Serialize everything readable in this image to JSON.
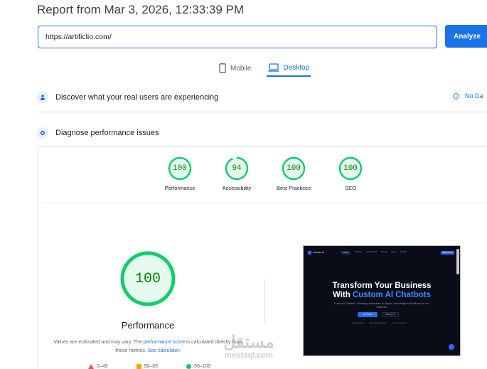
{
  "report": {
    "title": "Report from Mar 3, 2026, 12:33:39 PM"
  },
  "search": {
    "url": "https://artificlio.com/",
    "analyze_label": "Analyze"
  },
  "device_tabs": {
    "mobile": "Mobile",
    "desktop": "Desktop",
    "active": "desktop"
  },
  "sections": {
    "real_users": "Discover what your real users are experiencing",
    "no_data": "No Da",
    "diagnose": "Diagnose performance issues"
  },
  "scores": [
    {
      "label": "Performance",
      "value": "100",
      "fraction": 1.0,
      "color": "#0cce6b"
    },
    {
      "label": "Accessibility",
      "value": "94",
      "fraction": 0.94,
      "color": "#0cce6b"
    },
    {
      "label": "Best Practices",
      "value": "100",
      "fraction": 1.0,
      "color": "#0cce6b"
    },
    {
      "label": "SEO",
      "value": "100",
      "fraction": 1.0,
      "color": "#0cce6b"
    }
  ],
  "performance": {
    "score": "100",
    "title": "Performance",
    "note_pre": "Values are estimated and may vary. The ",
    "note_link1": "performance score",
    "note_mid": " is calculated directly from these metrics. ",
    "note_link2": "See calculator."
  },
  "legend": {
    "fail": "0–49",
    "average": "50–89",
    "pass": "90–100"
  },
  "screenshot": {
    "logo": "Artificlio AI",
    "nav": [
      "Home",
      "Services",
      "Case Studies",
      "Pricing",
      "About",
      "Contact"
    ],
    "cta": "Book a Call",
    "headline1": "Transform Your Business",
    "headline2_pre": "With ",
    "headline2_blue": "Custom AI Chatbots",
    "subtext": "Custom AI Chatbots, WhatsApp Automation, AI Agents, and Intelligent Workflows for Your Business.",
    "btn_primary": "Get Started",
    "btn_secondary": "WhatsApp Us",
    "features": [
      "24/7 Availability",
      "Multi-Channel Support",
      "Custom Integrations"
    ]
  },
  "watermark": {
    "arabic": "مستقل",
    "latin": "mostaql.com"
  },
  "colors": {
    "accent": "#1a73e8",
    "pass": "#0cce6b",
    "pass_text": "#008800"
  }
}
